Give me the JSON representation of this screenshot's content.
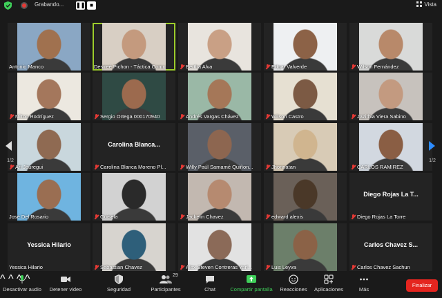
{
  "topbar": {
    "recording_label": "Grabando...",
    "pause_glyph": "❚❚",
    "stop_glyph": "■",
    "view_label": "Vista"
  },
  "pager": {
    "left": "1/2",
    "right": "1/2"
  },
  "tiles": [
    {
      "label": "Antonio Manco",
      "muted": false,
      "video": true,
      "bg": "#8aa7c4",
      "face": "#a0714f"
    },
    {
      "label": "Desireé Pichon - Táctica Comu",
      "muted": false,
      "video": true,
      "bg": "#d8cfc4",
      "face": "#c49a7e",
      "active": true
    },
    {
      "label": "Bertha Alva",
      "muted": true,
      "video": true,
      "bg": "#e8e4de",
      "face": "#c9a085"
    },
    {
      "label": "Edgar Valverde",
      "muted": true,
      "video": true,
      "bg": "#eef0f2",
      "face": "#8c6247"
    },
    {
      "label": "Wilson Fernández",
      "muted": true,
      "video": true,
      "bg": "#d9dad9",
      "face": "#b8896a"
    },
    {
      "label": "Nilton Rodríguez",
      "muted": true,
      "video": true,
      "bg": "#ece8e0",
      "face": "#a4775c"
    },
    {
      "label": "Sergio Ortega 000170940",
      "muted": true,
      "video": true,
      "bg": "#2f4a44",
      "face": "#9c6a4e"
    },
    {
      "label": "Andrés Vargas Chávez",
      "muted": true,
      "video": true,
      "bg": "#9ab8a6",
      "face": "#a57758"
    },
    {
      "label": "Wilson Castro",
      "muted": true,
      "video": true,
      "bg": "#e6e0d2",
      "face": "#7c5a44"
    },
    {
      "label": "Jazirhia Viera Sabino",
      "muted": true,
      "video": true,
      "bg": "#c7c2bd",
      "face": "#c39a80"
    },
    {
      "label": "Ari Jáuregui",
      "muted": true,
      "video": true,
      "bg": "#c9d7dd",
      "face": "#8f6a52"
    },
    {
      "label": "Carolina Blanca Moreno Pl...",
      "muted": true,
      "video": false,
      "big": "Carolina  Blanca..."
    },
    {
      "label": "Willy Paúl Samamé Quiñon...",
      "muted": true,
      "video": true,
      "bg": "#5a5f68",
      "face": "#8d6650"
    },
    {
      "label": "Jhonnatan",
      "muted": true,
      "video": true,
      "bg": "#d8cbb6",
      "face": "#d0b58f"
    },
    {
      "label": "CARLOS RAMIREZ",
      "muted": true,
      "video": true,
      "bg": "#d2d8e0",
      "face": "#8a5e44"
    },
    {
      "label": "José Del Rosario",
      "muted": false,
      "video": true,
      "bg": "#6fb4e0",
      "face": "#9a6e52"
    },
    {
      "label": "Guisela",
      "muted": true,
      "video": true,
      "bg": "#d2d2d2",
      "face": "#2a2a2a"
    },
    {
      "label": "Jackelin Chavez",
      "muted": true,
      "video": true,
      "bg": "#c2b8b0",
      "face": "#b68a70"
    },
    {
      "label": "edward alexis",
      "muted": true,
      "video": true,
      "bg": "#6a6058",
      "face": "#4a3828"
    },
    {
      "label": "Diego Rojas La Torre",
      "muted": true,
      "video": false,
      "big": "Diego Rojas La T..."
    },
    {
      "label": "Yessica Hilario",
      "muted": false,
      "video": false,
      "big": "Yessica Hilario"
    },
    {
      "label": "Sebastian Chavez",
      "muted": true,
      "video": true,
      "bg": "#d7d4cf",
      "face": "#2e5f7a"
    },
    {
      "label": "Alex Steven Contreras Yarl...",
      "muted": true,
      "video": true,
      "bg": "#e2e2e2",
      "face": "#8b6a58"
    },
    {
      "label": "Luis Leyva",
      "muted": true,
      "video": true,
      "bg": "#6c7f6a",
      "face": "#8b6247"
    },
    {
      "label": "Carlos Chavez Sachun",
      "muted": true,
      "video": false,
      "big": "Carlos Chavez S..."
    }
  ],
  "toolbar": {
    "mute_label": "Desactivar audio",
    "video_label": "Detener video",
    "security_label": "Seguridad",
    "participants_label": "Participantes",
    "participants_count": "29",
    "chat_label": "Chat",
    "share_label": "Compartir pantalla",
    "reactions_label": "Reacciones",
    "apps_label": "Aplicaciones",
    "more_label": "Más",
    "end_label": "Finalizar",
    "caret": "^"
  }
}
